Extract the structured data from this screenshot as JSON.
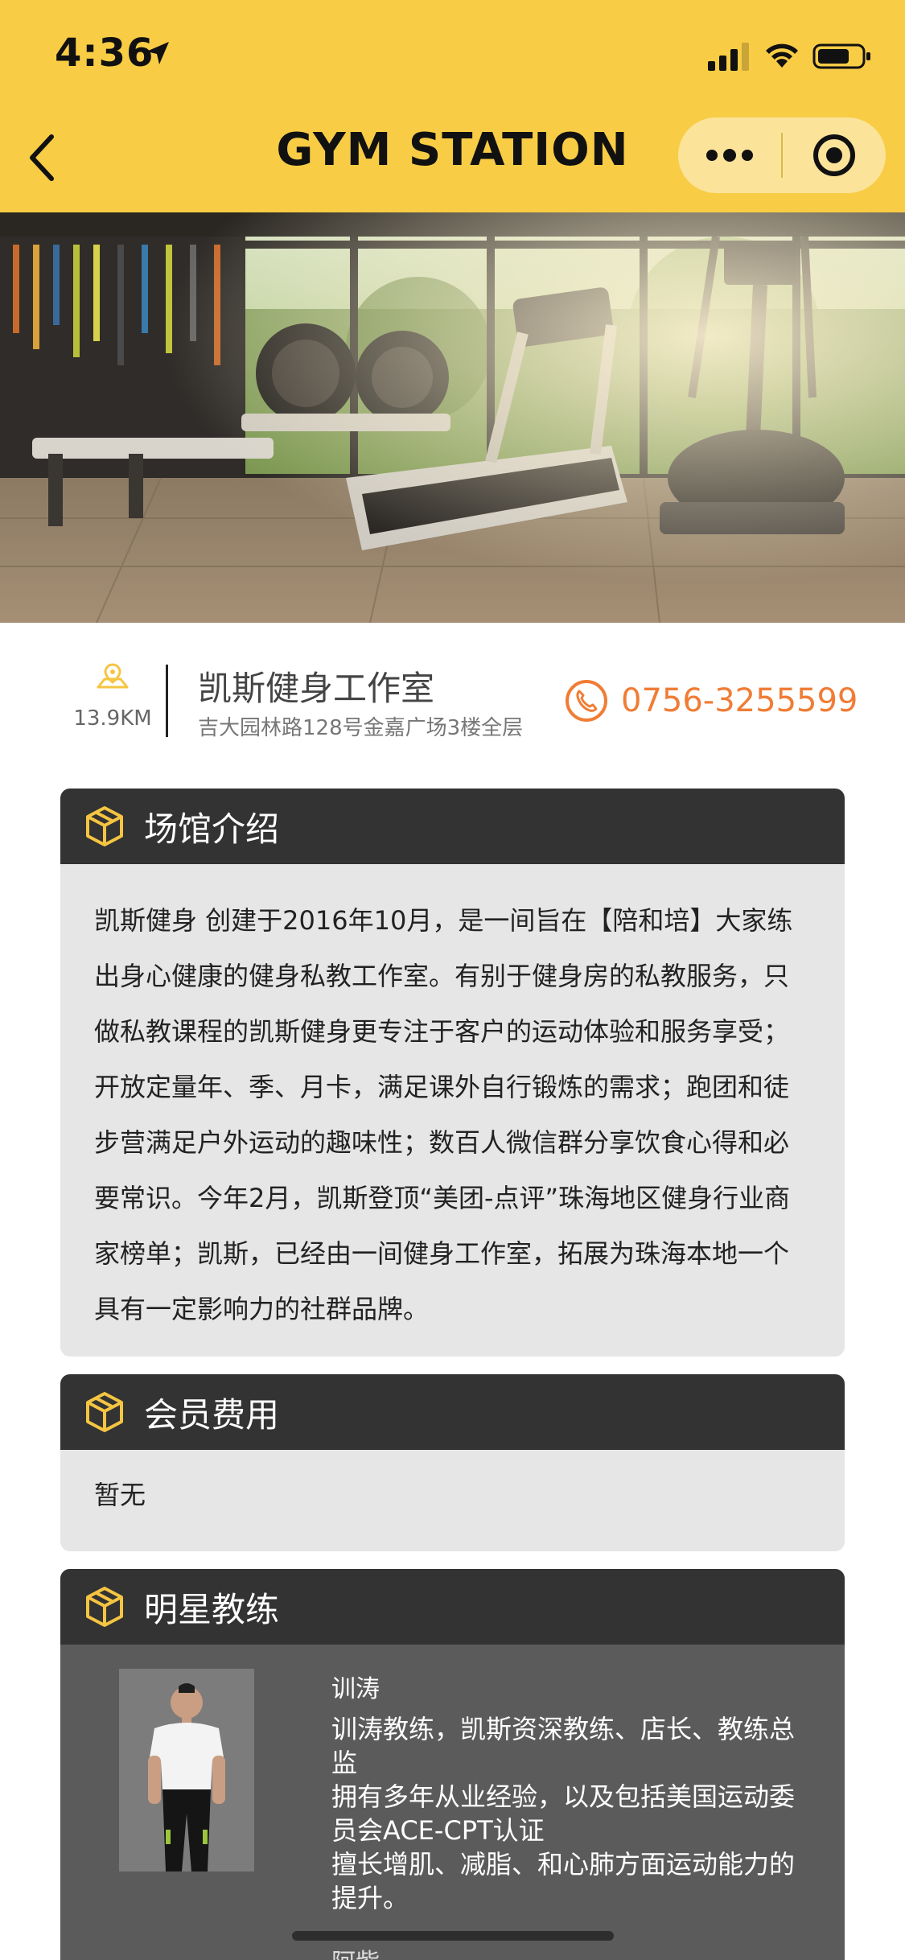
{
  "status_bar": {
    "time": "4:36"
  },
  "nav": {
    "title": "GYM STATION"
  },
  "gym": {
    "distance": "13.9KM",
    "name": "凯斯健身工作室",
    "address": "吉大园林路128号金嘉广场3楼全层",
    "phone": "0756-3255599"
  },
  "intro": {
    "title": "场馆介绍",
    "text": "凯斯健身 创建于2016年10月，是一间旨在【陪和培】大家练出身心健康的健身私教工作室。有别于健身房的私教服务，只做私教课程的凯斯健身更专注于客户的运动体验和服务享受；开放定量年、季、月卡，满足课外自行锻炼的需求；跑团和徒步营满足户外运动的趣味性；数百人微信群分享饮食心得和必要常识。今年2月，凯斯登顶“美团-点评”珠海地区健身行业商家榜单；凯斯，已经由一间健身工作室，拓展为珠海本地一个具有一定影响力的社群品牌。"
  },
  "fees": {
    "title": "会员费用",
    "text": "暂无"
  },
  "coaches": {
    "title": "明星教练",
    "items": [
      {
        "name": "训涛",
        "desc": "训涛教练，凯斯资深教练、店长、教练总监\n拥有多年从业经验，以及包括美国运动委员会ACE-CPT认证\n擅长增肌、减脂、和心肺方面运动能力的提升。"
      },
      {
        "name": "阿紫"
      }
    ]
  },
  "colors": {
    "header_bg": "#F8CC45",
    "accent_orange": "#F07D36",
    "icon_yellow": "#F5C542",
    "card_header_bg": "#333333",
    "card_body_bg": "#E6E6E6",
    "coach_bg": "#5B5B5B"
  },
  "icons": {
    "back": "chevron-left-icon",
    "more": "more-dots-icon",
    "close": "target-close-icon",
    "location": "location-icon",
    "phone": "phone-icon",
    "section": "cube-icon"
  }
}
